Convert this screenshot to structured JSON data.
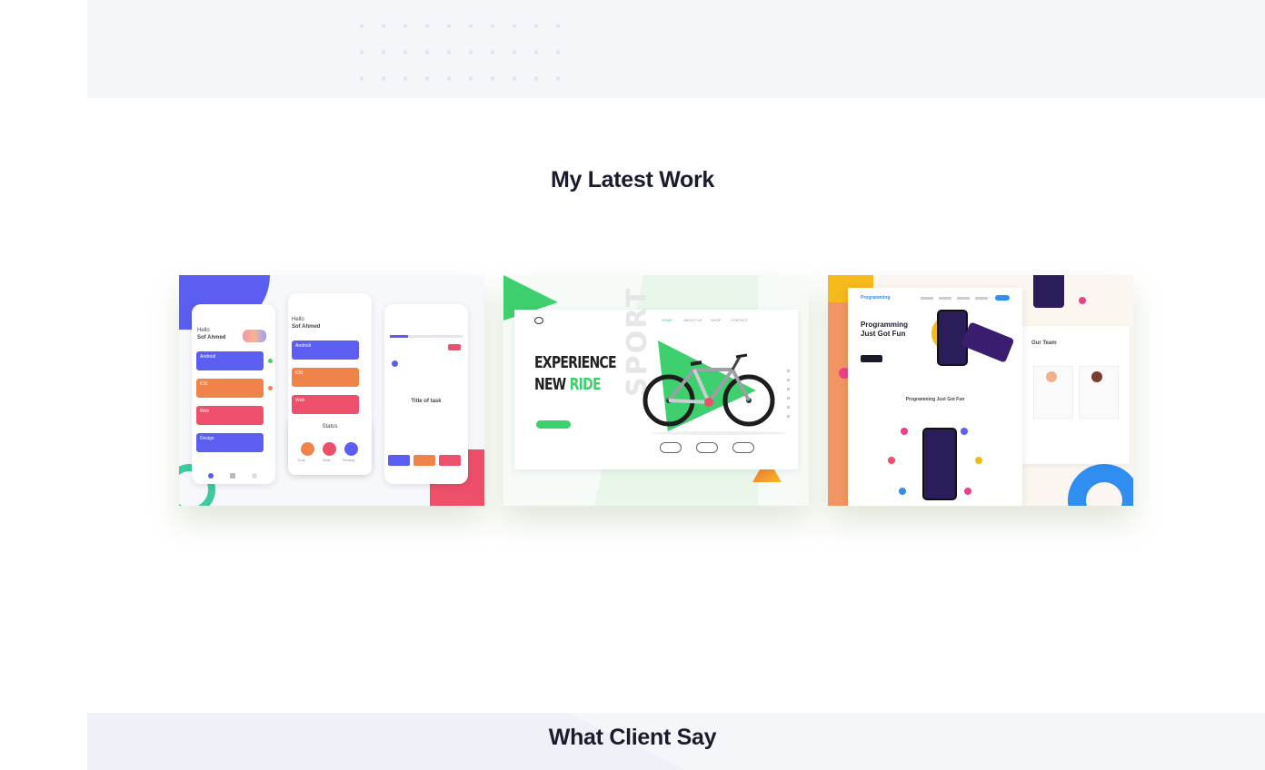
{
  "sections": {
    "work_title": "My Latest Work",
    "client_title": "What Client Say"
  },
  "work": {
    "cards": [
      {
        "kind": "task-app",
        "greeting": "Hello",
        "user": "Sof Ahmed",
        "tasks": [
          "Android",
          "iOS",
          "Web",
          "Design"
        ],
        "sub": [
          "To-do",
          "Done",
          "Pending"
        ],
        "details_label": "Title of task",
        "status_title": "Status"
      },
      {
        "kind": "bike-landing",
        "headline_1": "EXPERIENCE",
        "headline_2": "NEW",
        "headline_accent": "RIDE",
        "vertical_word": "SPORT",
        "nav": [
          "HOME",
          "ABOUT US",
          "SHOP",
          "CONTACT"
        ],
        "accent": "#3ecf6e"
      },
      {
        "kind": "programming-landing",
        "brand": "Programming",
        "hero_1": "Programming",
        "hero_2": "Just Got Fun",
        "section_title": "Programming Just Got Fun",
        "team_title": "Our Team"
      }
    ]
  },
  "colors": {
    "purple": "#5b5ef0",
    "orange": "#f0834a",
    "red": "#ee4f6a",
    "green": "#3ecf6e",
    "blue": "#2f8ef0",
    "yellow": "#f6b91c",
    "pink": "#ef3f8c"
  }
}
